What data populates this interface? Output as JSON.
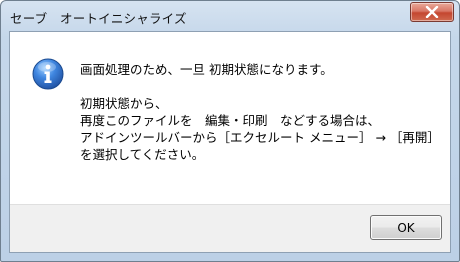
{
  "window": {
    "title": "セーブ　オートイニシャライズ"
  },
  "dialog": {
    "icon": "info-icon",
    "message_lines": [
      "画面処理のため、一旦 初期状態になります。",
      "",
      "初期状態から、",
      "再度このファイルを　編集・印刷　などする場合は、",
      "アドインツールバーから［エクセルート メニュー］ → ［再開］",
      "を選択してください。"
    ],
    "ok_label": "OK"
  },
  "colors": {
    "icon_blue": "#2f6fc6",
    "close_red": "#c4462f"
  }
}
